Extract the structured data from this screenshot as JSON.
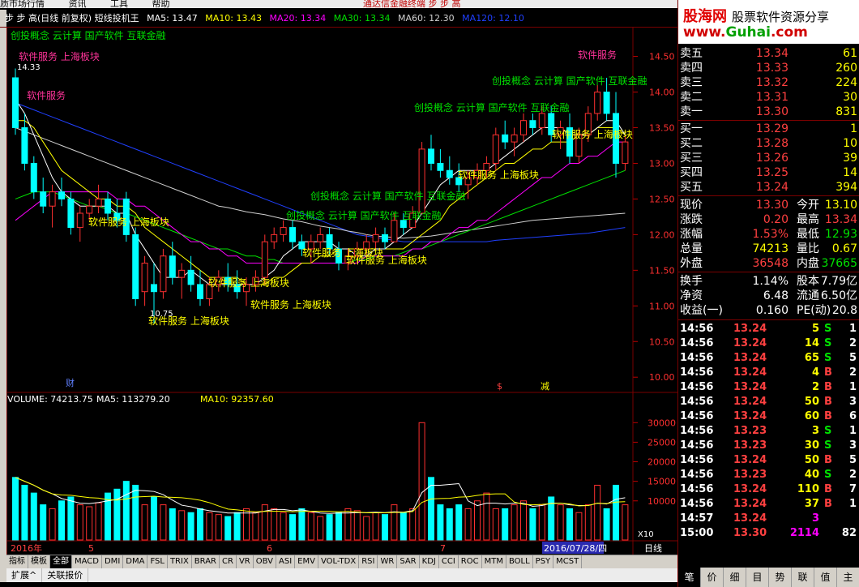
{
  "menu": {
    "items": [
      "质市场行情",
      "资讯",
      "工具",
      "帮助"
    ],
    "center": "通达信金融终端   步 步 高"
  },
  "title": {
    "stock": "步 步 高(日线 前复权) 短线投机王",
    "ma5": "MA5: 13.47",
    "ma10": "MA10: 13.43",
    "ma20": "MA20: 13.34",
    "ma30": "MA30: 13.34",
    "ma60": "MA60: 12.30",
    "ma120": "MA120: 12.10"
  },
  "concepts_label": "创投概念 云计算 国产软件 互联金融",
  "ann": {
    "sw1": "软件服务 上海板块",
    "sw": "软件服务",
    "cb": "创投概念 云计算 国产软件 互联金融",
    "sw_sh": "软件服务 上海板块",
    "hi": "14.33",
    "lo": "10.75"
  },
  "markers": {
    "cai": "财",
    "x": "$",
    "jian": "减"
  },
  "price_ticks": [
    "14.50",
    "14.00",
    "13.50",
    "13.00",
    "12.50",
    "12.00",
    "11.50",
    "11.00",
    "10.50",
    "10.00"
  ],
  "volume": {
    "label": "VOLUME: 74213.75",
    "ma5": "MA5: 113279.20",
    "ma10": "MA10: 92357.60",
    "ticks": [
      "30000",
      "25000",
      "20000",
      "15000",
      "10000"
    ]
  },
  "date_axis": {
    "labels": [
      "2016年",
      "5",
      "6",
      "7"
    ],
    "current": "2016/07/28/四",
    "zoom": "X10",
    "period": "日线"
  },
  "indicator_tabs": [
    "指标",
    "模板",
    "全部",
    "MACD",
    "DMI",
    "DMA",
    "FSL",
    "TRIX",
    "BRAR",
    "CR",
    "VR",
    "OBV",
    "ASI",
    "EMV",
    "VOL-TDX",
    "RSI",
    "WR",
    "SAR",
    "KDJ",
    "CCI",
    "ROC",
    "MTM",
    "BOLL",
    "PSY",
    "MCST"
  ],
  "bottom_tabs": [
    "扩展^",
    "关联报价"
  ],
  "chart_data": {
    "type": "candlestick",
    "ylim": [
      9.9,
      14.7
    ],
    "ohlc": [
      [
        14.2,
        14.33,
        13.4,
        13.5
      ],
      [
        13.5,
        13.7,
        12.9,
        13.0
      ],
      [
        13.0,
        13.1,
        12.5,
        12.6
      ],
      [
        12.6,
        12.8,
        12.3,
        12.4
      ],
      [
        12.4,
        12.7,
        12.1,
        12.6
      ],
      [
        12.6,
        12.8,
        12.4,
        12.5
      ],
      [
        12.5,
        12.6,
        12.0,
        12.1
      ],
      [
        12.1,
        12.4,
        11.9,
        12.3
      ],
      [
        12.3,
        12.5,
        12.2,
        12.4
      ],
      [
        12.4,
        12.7,
        12.3,
        12.5
      ],
      [
        12.5,
        12.6,
        12.2,
        12.3
      ],
      [
        12.3,
        12.5,
        12.1,
        12.2
      ],
      [
        12.5,
        12.6,
        11.9,
        12.0
      ],
      [
        12.0,
        12.1,
        11.0,
        11.1
      ],
      [
        11.2,
        11.7,
        11.0,
        11.6
      ],
      [
        11.3,
        11.6,
        10.75,
        11.2
      ],
      [
        11.2,
        11.8,
        11.1,
        11.7
      ],
      [
        11.7,
        11.9,
        11.3,
        11.4
      ],
      [
        11.4,
        11.6,
        11.1,
        11.5
      ],
      [
        11.5,
        11.7,
        11.2,
        11.3
      ],
      [
        11.3,
        11.5,
        11.0,
        11.1
      ],
      [
        11.1,
        11.4,
        11.0,
        11.3
      ],
      [
        11.3,
        11.5,
        11.2,
        11.4
      ],
      [
        11.4,
        11.6,
        11.2,
        11.3
      ],
      [
        11.3,
        11.5,
        11.1,
        11.2
      ],
      [
        11.2,
        11.4,
        11.0,
        11.3
      ],
      [
        11.3,
        11.5,
        11.2,
        11.4
      ],
      [
        11.4,
        12.0,
        11.3,
        11.9
      ],
      [
        11.9,
        12.1,
        11.8,
        12.0
      ],
      [
        12.0,
        12.2,
        11.9,
        12.1
      ],
      [
        12.1,
        12.2,
        11.8,
        11.9
      ],
      [
        11.9,
        12.0,
        11.7,
        11.8
      ],
      [
        11.8,
        12.0,
        11.6,
        11.9
      ],
      [
        11.9,
        12.1,
        11.8,
        12.0
      ],
      [
        12.0,
        12.1,
        11.7,
        11.8
      ],
      [
        11.8,
        11.9,
        11.5,
        11.6
      ],
      [
        11.6,
        11.8,
        11.5,
        11.7
      ],
      [
        11.7,
        11.9,
        11.6,
        11.8
      ],
      [
        11.8,
        12.0,
        11.7,
        11.9
      ],
      [
        11.9,
        12.1,
        11.8,
        12.0
      ],
      [
        12.0,
        12.1,
        11.8,
        11.9
      ],
      [
        11.9,
        12.3,
        11.9,
        12.2
      ],
      [
        12.2,
        12.3,
        12.0,
        12.1
      ],
      [
        12.1,
        12.4,
        12.1,
        12.3
      ],
      [
        12.3,
        13.3,
        12.3,
        13.2
      ],
      [
        13.2,
        13.4,
        12.9,
        13.0
      ],
      [
        13.0,
        13.2,
        12.8,
        12.9
      ],
      [
        12.9,
        13.1,
        12.7,
        12.8
      ],
      [
        12.8,
        13.0,
        12.6,
        12.7
      ],
      [
        12.7,
        12.9,
        12.5,
        12.8
      ],
      [
        12.8,
        13.0,
        12.7,
        12.9
      ],
      [
        12.9,
        13.1,
        12.8,
        13.0
      ],
      [
        13.0,
        13.5,
        12.9,
        13.4
      ],
      [
        13.4,
        13.6,
        13.2,
        13.3
      ],
      [
        13.3,
        13.5,
        13.1,
        13.4
      ],
      [
        13.4,
        13.7,
        13.3,
        13.6
      ],
      [
        13.6,
        13.7,
        13.4,
        13.5
      ],
      [
        13.5,
        13.8,
        13.4,
        13.7
      ],
      [
        13.7,
        13.8,
        13.3,
        13.4
      ],
      [
        13.4,
        13.6,
        13.2,
        13.5
      ],
      [
        13.5,
        13.7,
        13.0,
        13.1
      ],
      [
        13.1,
        13.5,
        13.0,
        13.4
      ],
      [
        13.4,
        13.8,
        13.3,
        13.7
      ],
      [
        13.7,
        14.1,
        13.6,
        14.0
      ],
      [
        14.0,
        14.2,
        13.6,
        13.7
      ],
      [
        13.7,
        14.0,
        12.8,
        13.0
      ],
      [
        13.0,
        13.4,
        12.9,
        13.3
      ]
    ],
    "ma5": [
      13.9,
      13.7,
      13.4,
      13.1,
      12.8,
      12.6,
      12.5,
      12.4,
      12.4,
      12.4,
      12.4,
      12.3,
      12.3,
      12.0,
      11.8,
      11.6,
      11.4,
      11.4,
      11.4,
      11.5,
      11.4,
      11.3,
      11.3,
      11.3,
      11.3,
      11.3,
      11.3,
      11.4,
      11.5,
      11.7,
      11.8,
      11.9,
      11.9,
      11.9,
      11.9,
      11.8,
      11.8,
      11.7,
      11.7,
      11.8,
      11.8,
      11.9,
      12.0,
      12.1,
      12.3,
      12.5,
      12.7,
      12.8,
      12.9,
      12.9,
      12.9,
      12.9,
      13.0,
      13.1,
      13.2,
      13.3,
      13.4,
      13.5,
      13.5,
      13.5,
      13.4,
      13.4,
      13.4,
      13.5,
      13.6,
      13.6,
      13.4
    ],
    "ma10": [
      13.6,
      13.6,
      13.5,
      13.3,
      13.1,
      12.9,
      12.8,
      12.7,
      12.6,
      12.5,
      12.5,
      12.4,
      12.4,
      12.3,
      12.1,
      12.0,
      11.9,
      11.8,
      11.7,
      11.6,
      11.5,
      11.4,
      11.4,
      11.4,
      11.4,
      11.3,
      11.3,
      11.3,
      11.4,
      11.4,
      11.5,
      11.6,
      11.6,
      11.7,
      11.7,
      11.8,
      11.8,
      11.8,
      11.8,
      11.8,
      11.8,
      11.8,
      11.8,
      11.9,
      12.0,
      12.1,
      12.2,
      12.4,
      12.5,
      12.6,
      12.7,
      12.8,
      12.9,
      13.0,
      13.0,
      13.1,
      13.2,
      13.2,
      13.3,
      13.3,
      13.3,
      13.4,
      13.4,
      13.5,
      13.5,
      13.5,
      13.4
    ],
    "ma20": [
      12.2,
      12.3,
      12.4,
      12.5,
      12.6,
      12.6,
      12.6,
      12.6,
      12.6,
      12.6,
      12.6,
      12.5,
      12.5,
      12.4,
      12.4,
      12.3,
      12.2,
      12.1,
      12.0,
      11.9,
      11.9,
      11.8,
      11.8,
      11.7,
      11.7,
      11.6,
      11.6,
      11.6,
      11.6,
      11.6,
      11.6,
      11.6,
      11.6,
      11.6,
      11.6,
      11.6,
      11.6,
      11.6,
      11.7,
      11.7,
      11.7,
      11.7,
      11.7,
      11.8,
      11.8,
      11.9,
      11.9,
      12.0,
      12.1,
      12.1,
      12.2,
      12.2,
      12.3,
      12.4,
      12.5,
      12.6,
      12.7,
      12.8,
      12.8,
      12.9,
      13.0,
      13.0,
      13.1,
      13.1,
      13.2,
      13.3,
      13.3
    ],
    "ma30": [
      12.5,
      12.55,
      12.6,
      12.6,
      12.6,
      12.55,
      12.5,
      12.45,
      12.4,
      12.4,
      12.35,
      12.3,
      12.3,
      12.25,
      12.2,
      12.15,
      12.1,
      12.05,
      12.0,
      11.95,
      11.9,
      11.85,
      11.8,
      11.8,
      11.75,
      11.7,
      11.7,
      11.65,
      11.65,
      11.6,
      11.6,
      11.6,
      11.6,
      11.6,
      11.6,
      11.6,
      11.6,
      11.65,
      11.65,
      11.7,
      11.7,
      11.7,
      11.75,
      11.8,
      11.8,
      11.85,
      11.9,
      11.95,
      12.0,
      12.05,
      12.1,
      12.15,
      12.2,
      12.25,
      12.3,
      12.35,
      12.4,
      12.45,
      12.5,
      12.55,
      12.6,
      12.65,
      12.7,
      12.75,
      12.8,
      12.85,
      12.9
    ],
    "ma60": [
      13.5,
      13.45,
      13.4,
      13.35,
      13.3,
      13.25,
      13.2,
      13.15,
      13.1,
      13.05,
      13.0,
      12.95,
      12.9,
      12.85,
      12.8,
      12.75,
      12.7,
      12.65,
      12.6,
      12.55,
      12.5,
      12.45,
      12.4,
      12.38,
      12.35,
      12.32,
      12.3,
      12.28,
      12.25,
      12.22,
      12.2,
      12.18,
      12.15,
      12.12,
      12.1,
      12.08,
      12.05,
      12.03,
      12.0,
      11.98,
      11.97,
      11.96,
      11.95,
      11.96,
      11.97,
      11.98,
      12.0,
      12.02,
      12.04,
      12.06,
      12.08,
      12.1,
      12.12,
      12.14,
      12.16,
      12.18,
      12.2,
      12.21,
      12.22,
      12.23,
      12.24,
      12.25,
      12.26,
      12.27,
      12.28,
      12.29,
      12.3
    ],
    "ma120": [
      13.85,
      13.8,
      13.75,
      13.7,
      13.65,
      13.6,
      13.55,
      13.5,
      13.45,
      13.4,
      13.35,
      13.3,
      13.25,
      13.2,
      13.15,
      13.1,
      13.05,
      13.0,
      12.95,
      12.9,
      12.85,
      12.8,
      12.75,
      12.7,
      12.65,
      12.6,
      12.55,
      12.5,
      12.45,
      12.4,
      12.35,
      12.3,
      12.25,
      12.2,
      12.15,
      12.1,
      12.05,
      12.0,
      11.98,
      11.96,
      11.94,
      11.92,
      11.9,
      11.9,
      11.9,
      11.9,
      11.9,
      11.9,
      11.9,
      11.9,
      11.9,
      11.9,
      11.92,
      11.93,
      11.94,
      11.95,
      11.96,
      11.97,
      11.98,
      11.99,
      12.0,
      12.01,
      12.02,
      12.04,
      12.06,
      12.08,
      12.1
    ],
    "volume": {
      "ylim": [
        0,
        34000
      ],
      "values": [
        16000,
        14000,
        12000,
        9000,
        8000,
        10000,
        11000,
        9000,
        8500,
        9500,
        12000,
        13000,
        15000,
        14000,
        9000,
        11000,
        9000,
        8000,
        7500,
        7000,
        8000,
        7000,
        6500,
        6000,
        7000,
        8000,
        7000,
        9000,
        8000,
        7000,
        6500,
        8000,
        7000,
        6000,
        6500,
        7000,
        8000,
        7500,
        6000,
        7000,
        6500,
        9000,
        7000,
        8000,
        30000,
        16000,
        9000,
        8000,
        9000,
        8000,
        10000,
        12000,
        8000,
        8000,
        9000,
        10000,
        8000,
        9000,
        11000,
        9000,
        8000,
        7000,
        9000,
        14000,
        8000,
        14000,
        9000
      ]
    }
  },
  "quote": {
    "asks": [
      {
        "label": "卖五",
        "price": "13.34",
        "vol": "61"
      },
      {
        "label": "卖四",
        "price": "13.33",
        "vol": "260"
      },
      {
        "label": "卖三",
        "price": "13.32",
        "vol": "224"
      },
      {
        "label": "卖二",
        "price": "13.31",
        "vol": "30"
      },
      {
        "label": "卖一",
        "price": "13.30",
        "vol": "831"
      }
    ],
    "bids": [
      {
        "label": "买一",
        "price": "13.29",
        "vol": "1"
      },
      {
        "label": "买二",
        "price": "13.28",
        "vol": "10"
      },
      {
        "label": "买三",
        "price": "13.26",
        "vol": "39"
      },
      {
        "label": "买四",
        "price": "13.25",
        "vol": "14"
      },
      {
        "label": "买五",
        "price": "13.24",
        "vol": "394"
      }
    ],
    "stats": [
      [
        "现价",
        "13.30",
        "今开",
        "13.10"
      ],
      [
        "涨跌",
        "0.20",
        "最高",
        "13.34"
      ],
      [
        "涨幅",
        "1.53%",
        "最低",
        "12.93"
      ],
      [
        "总量",
        "74213",
        "量比",
        "0.67"
      ],
      [
        "外盘",
        "36548",
        "内盘",
        "37665"
      ]
    ],
    "fund": [
      [
        "换手",
        "1.14%",
        "股本",
        "7.79亿"
      ],
      [
        "净资",
        "6.48",
        "流通",
        "6.50亿"
      ],
      [
        "收益(一)",
        "0.160",
        "PE(动)",
        "20.8"
      ]
    ]
  },
  "ticks": [
    [
      "14:56",
      "13.24",
      "5",
      "S",
      "1"
    ],
    [
      "14:56",
      "13.24",
      "14",
      "S",
      "2"
    ],
    [
      "14:56",
      "13.24",
      "65",
      "S",
      "5"
    ],
    [
      "14:56",
      "13.24",
      "4",
      "B",
      "2"
    ],
    [
      "14:56",
      "13.24",
      "2",
      "B",
      "1"
    ],
    [
      "14:56",
      "13.24",
      "50",
      "B",
      "3"
    ],
    [
      "14:56",
      "13.24",
      "60",
      "B",
      "6"
    ],
    [
      "14:56",
      "13.23",
      "3",
      "S",
      "1"
    ],
    [
      "14:56",
      "13.23",
      "30",
      "S",
      "3"
    ],
    [
      "14:56",
      "13.24",
      "50",
      "B",
      "5"
    ],
    [
      "14:56",
      "13.23",
      "40",
      "S",
      "2"
    ],
    [
      "14:56",
      "13.24",
      "110",
      "B",
      "7"
    ],
    [
      "14:56",
      "13.24",
      "37",
      "B",
      "1"
    ],
    [
      "14:57",
      "13.24",
      "3",
      "",
      ""
    ],
    [
      "15:00",
      "13.30",
      "2114",
      "",
      "82"
    ]
  ],
  "right_tabs": [
    "笔",
    "价",
    "细",
    "目",
    "势",
    "联",
    "值",
    "主"
  ],
  "logo": {
    "name": "股海网",
    "slogan": "股票软件资源分享",
    "url_a": "www.",
    "url_b": "Guhai",
    "url_c": ".com"
  }
}
